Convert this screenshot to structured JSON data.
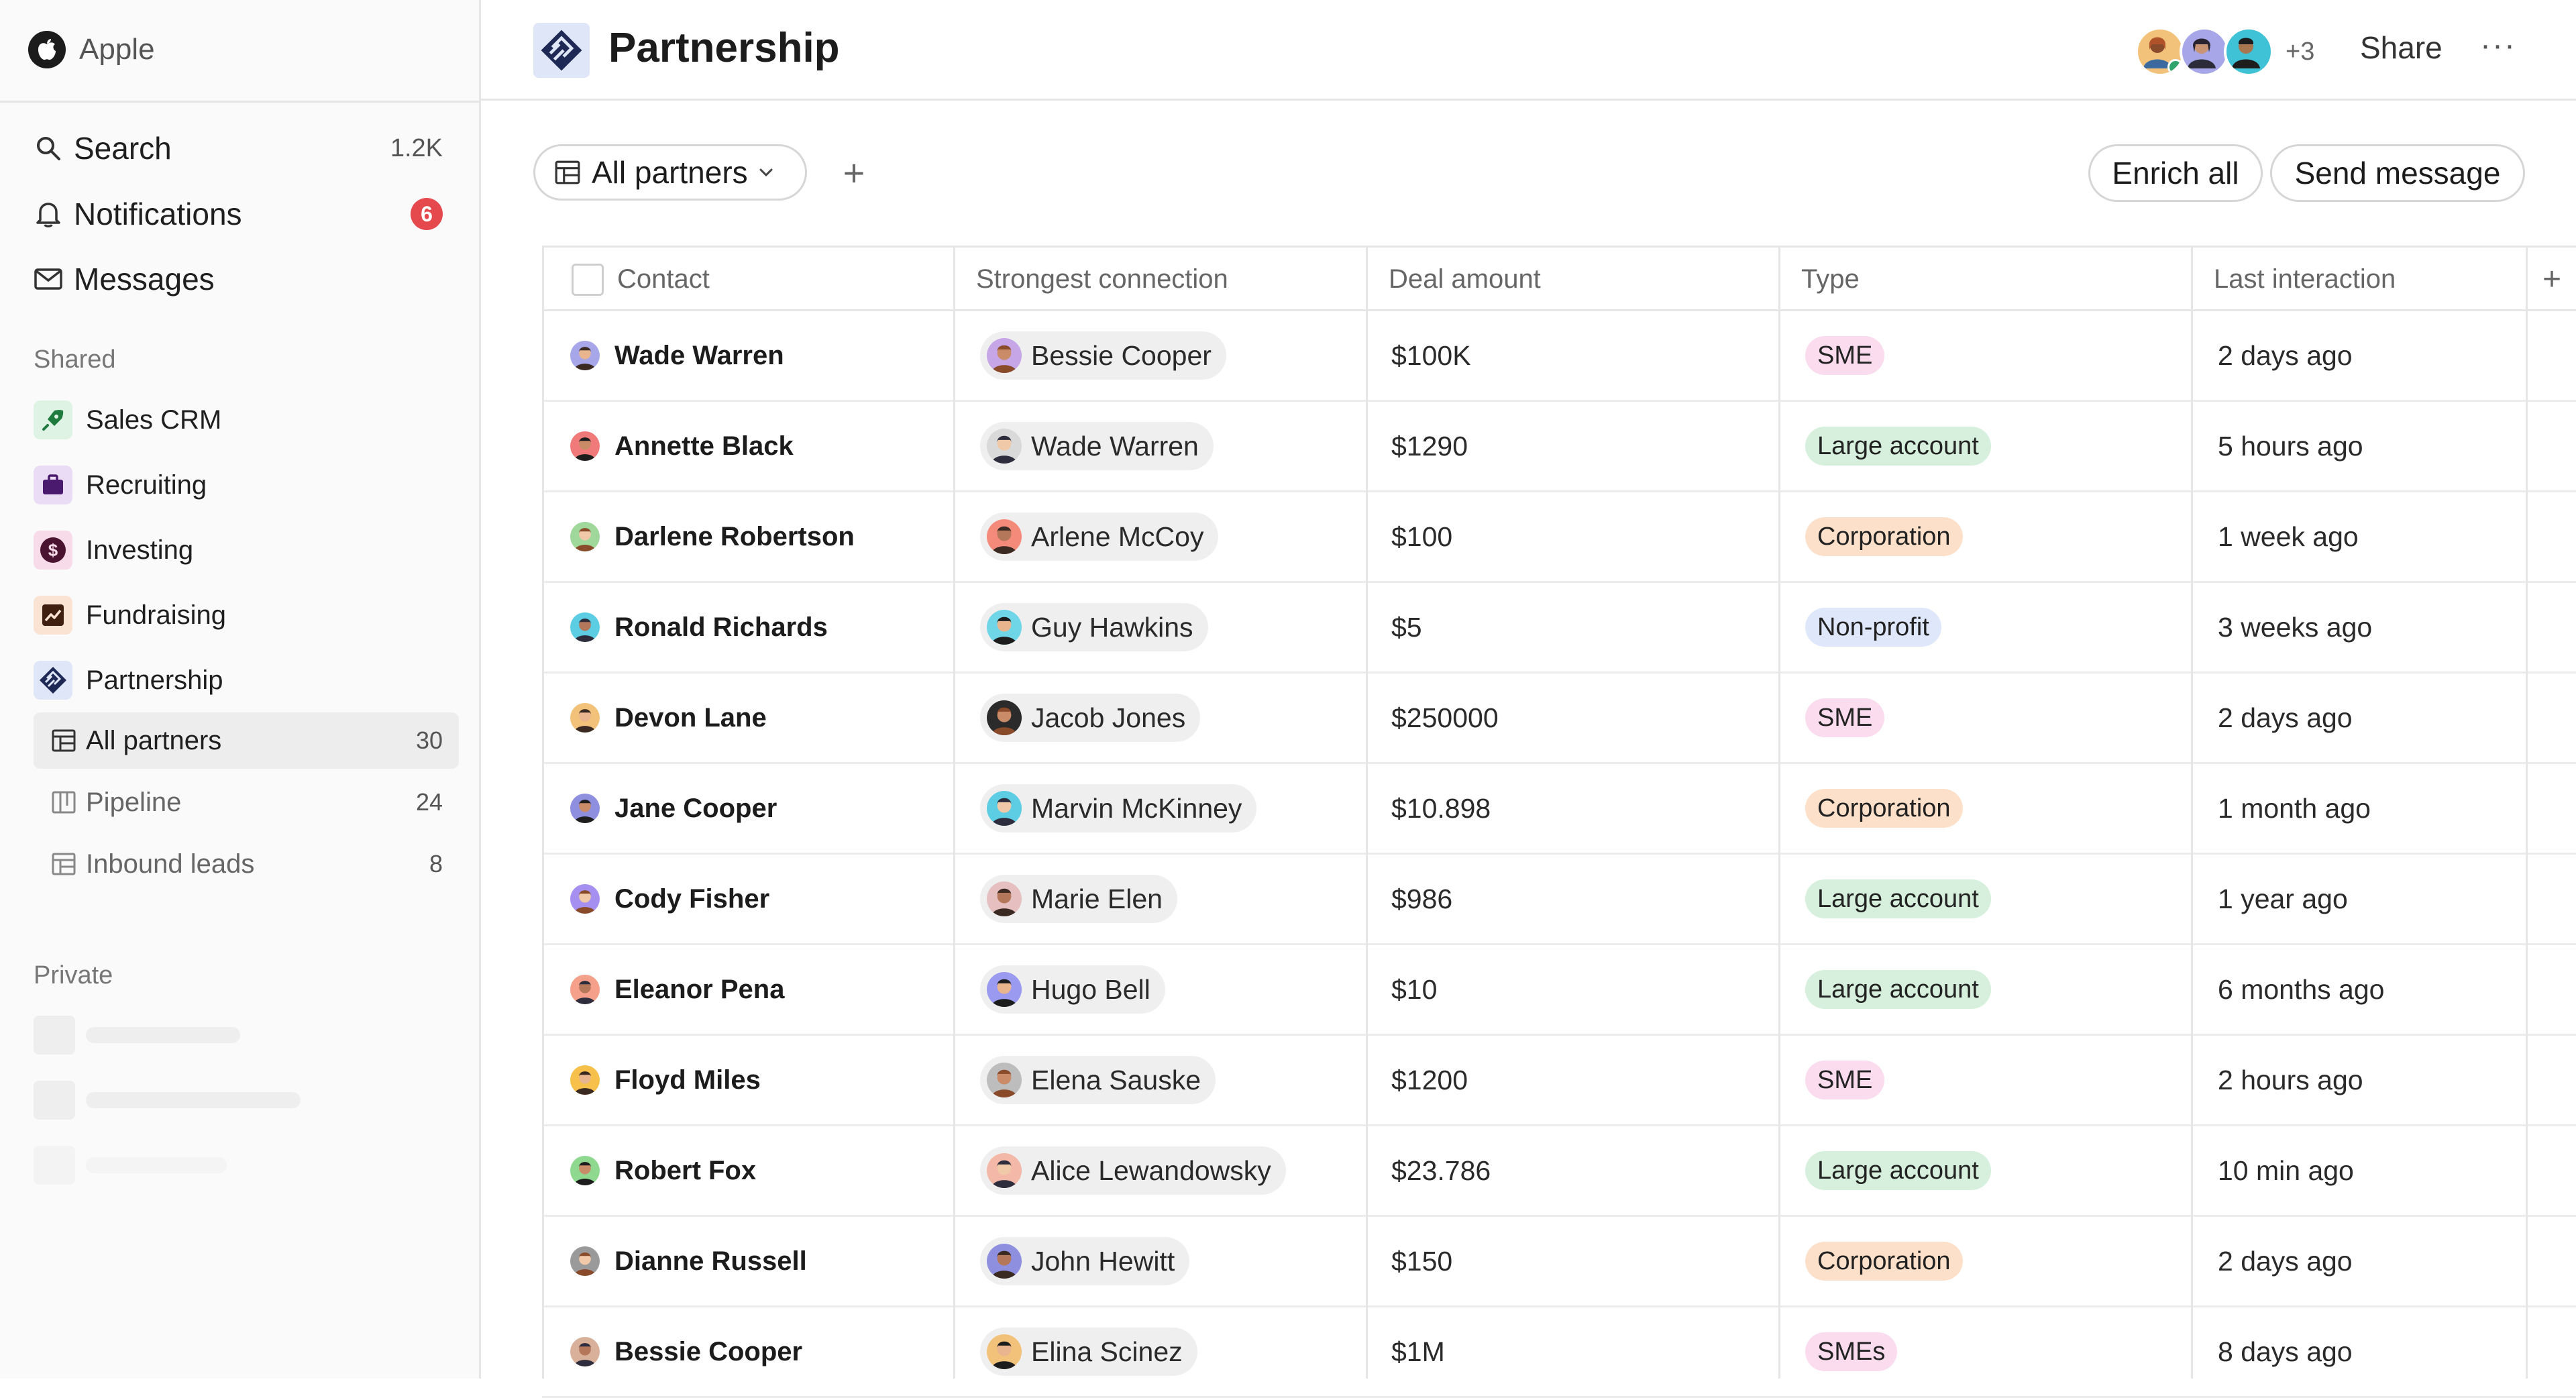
{
  "workspace": {
    "name": "Apple"
  },
  "nav": {
    "search_label": "Search",
    "search_count": "1.2K",
    "notifications_label": "Notifications",
    "notifications_count": "6",
    "messages_label": "Messages"
  },
  "sidebar": {
    "shared_label": "Shared",
    "private_label": "Private",
    "spaces": [
      {
        "label": "Sales CRM",
        "color": "#dff3e4",
        "icon": "rocket-icon"
      },
      {
        "label": "Recruiting",
        "color": "#eadcf5",
        "icon": "briefcase-icon"
      },
      {
        "label": "Investing",
        "color": "#f7dbe9",
        "icon": "dollar-icon"
      },
      {
        "label": "Fundraising",
        "color": "#fbe3d3",
        "icon": "trend-icon"
      },
      {
        "label": "Partnership",
        "color": "#dfe6f7",
        "icon": "partnership-icon"
      }
    ],
    "views": [
      {
        "label": "All partners",
        "count": "30"
      },
      {
        "label": "Pipeline",
        "count": "24"
      },
      {
        "label": "Inbound leads",
        "count": "8"
      }
    ]
  },
  "header": {
    "title": "Partnership",
    "extra_collaborators": "+3",
    "share_label": "Share",
    "more_label": "···"
  },
  "toolbar": {
    "view_label": "All partners",
    "add_view": "+",
    "enrich_label": "Enrich all",
    "send_label": "Send message"
  },
  "table": {
    "columns": {
      "contact": "Contact",
      "connection": "Strongest connection",
      "amount": "Deal amount",
      "type": "Type",
      "last": "Last interaction",
      "add": "+"
    },
    "rows": [
      {
        "contact": "Wade Warren",
        "connection": "Bessie Cooper",
        "amount": "$100K",
        "type": "SME",
        "last": "2 days ago"
      },
      {
        "contact": "Annette Black",
        "connection": "Wade Warren",
        "amount": "$1290",
        "type": "Large account",
        "last": "5 hours ago"
      },
      {
        "contact": "Darlene Robertson",
        "connection": "Arlene McCoy",
        "amount": "$100",
        "type": "Corporation",
        "last": "1 week ago"
      },
      {
        "contact": "Ronald Richards",
        "connection": "Guy Hawkins",
        "amount": "$5",
        "type": "Non-profit",
        "last": "3 weeks ago"
      },
      {
        "contact": "Devon Lane",
        "connection": "Jacob Jones",
        "amount": "$250000",
        "type": "SME",
        "last": "2 days ago"
      },
      {
        "contact": "Jane Cooper",
        "connection": "Marvin McKinney",
        "amount": "$10.898",
        "type": "Corporation",
        "last": "1 month ago"
      },
      {
        "contact": "Cody Fisher",
        "connection": "Marie Elen",
        "amount": "$986",
        "type": "Large account",
        "last": "1 year ago"
      },
      {
        "contact": "Eleanor Pena",
        "connection": "Hugo Bell",
        "amount": "$10",
        "type": "Large account",
        "last": "6 months ago"
      },
      {
        "contact": "Floyd Miles",
        "connection": "Elena Sauske",
        "amount": "$1200",
        "type": "SME",
        "last": "2 hours ago"
      },
      {
        "contact": "Robert Fox",
        "connection": "Alice Lewandowsky",
        "amount": "$23.786",
        "type": "Large account",
        "last": "10 min ago"
      },
      {
        "contact": "Dianne Russell",
        "connection": "John Hewitt",
        "amount": "$150",
        "type": "Corporation",
        "last": "2 days ago"
      },
      {
        "contact": "Bessie Cooper",
        "connection": "Elina Scinez",
        "amount": "$1M",
        "type": "SMEs",
        "last": "8 days ago"
      }
    ]
  },
  "colors": {
    "SME": "#fbdcef",
    "Large account": "#d6f0dd",
    "Corporation": "#fde0c9",
    "Non-profit": "#dfe7fb",
    "SMEs": "#fbdcef",
    "notification_badge": "#e5484d"
  }
}
